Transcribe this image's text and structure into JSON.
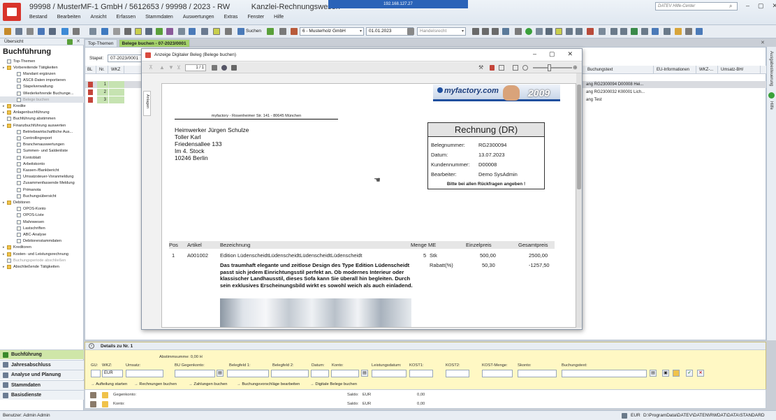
{
  "window": {
    "title": "99998 / MusterMF-1 GmbH / 5612653 / 99998 / 2023 - RW",
    "title_suffix": "Kanzlei-Rechnungswesen",
    "remote_ip": "192.168.127.27",
    "help_center_placeholder": "DATEV Hilfe-Center",
    "menu": [
      "Bestand",
      "Bearbeiten",
      "Ansicht",
      "Erfassen",
      "Stammdaten",
      "Auswertungen",
      "Extras",
      "Fenster",
      "Hilfe"
    ]
  },
  "toolbar": {
    "search_label": "Suchen",
    "client_select": "6 - Musterholz GmbH",
    "date_select": "01.01.2023",
    "law_select": "Handelsrecht"
  },
  "left_panel": {
    "header": "Übersicht",
    "title": "Buchführung",
    "items": [
      {
        "label": "Top-Themen",
        "level": 0,
        "kind": "leaf"
      },
      {
        "label": "Vorbereitende Tätigkeiten",
        "level": 0,
        "kind": "folder"
      },
      {
        "label": "Mandant ergänzen",
        "level": 1,
        "kind": "leaf"
      },
      {
        "label": "ASCII-Daten importieren",
        "level": 1,
        "kind": "leaf"
      },
      {
        "label": "Stapelverwaltung",
        "level": 1,
        "kind": "leaf"
      },
      {
        "label": "Wiederkehrende Buchunge...",
        "level": 1,
        "kind": "leaf"
      },
      {
        "label": "Belege buchen",
        "level": 1,
        "kind": "leaf",
        "state": "selected"
      },
      {
        "label": "Kredite",
        "level": 0,
        "kind": "folder"
      },
      {
        "label": "Anlagenbuchführung",
        "level": 0,
        "kind": "folder"
      },
      {
        "label": "Buchführung abstimmen",
        "level": 0,
        "kind": "leaf"
      },
      {
        "label": "Finanzbuchführung auswerten",
        "level": 0,
        "kind": "folder"
      },
      {
        "label": "Betriebswirtschaftliche Aus...",
        "level": 1,
        "kind": "leaf"
      },
      {
        "label": "Controllingreport",
        "level": 1,
        "kind": "leaf"
      },
      {
        "label": "Branchenauswertungen",
        "level": 1,
        "kind": "leaf"
      },
      {
        "label": "Summen- und Saldenliste",
        "level": 1,
        "kind": "leaf"
      },
      {
        "label": "Kontoblatt",
        "level": 1,
        "kind": "leaf"
      },
      {
        "label": "Arbeitskonto",
        "level": 1,
        "kind": "leaf"
      },
      {
        "label": "Kassen-/Bankbericht",
        "level": 1,
        "kind": "leaf"
      },
      {
        "label": "Umsatzsteuer-Voranmeldung",
        "level": 1,
        "kind": "leaf"
      },
      {
        "label": "Zusammenfassende Meldung",
        "level": 1,
        "kind": "leaf"
      },
      {
        "label": "Primanota",
        "level": 1,
        "kind": "leaf"
      },
      {
        "label": "Buchungsübersicht",
        "level": 1,
        "kind": "leaf"
      },
      {
        "label": "Debitoren",
        "level": 0,
        "kind": "folder"
      },
      {
        "label": "OPOS-Konto",
        "level": 1,
        "kind": "leaf"
      },
      {
        "label": "OPOS-Liste",
        "level": 1,
        "kind": "leaf"
      },
      {
        "label": "Mahnwesen",
        "level": 1,
        "kind": "leaf"
      },
      {
        "label": "Lastschriften",
        "level": 1,
        "kind": "leaf"
      },
      {
        "label": "ABC-Analyse",
        "level": 1,
        "kind": "leaf"
      },
      {
        "label": "Debitorenstammdaten",
        "level": 1,
        "kind": "leaf"
      },
      {
        "label": "Kreditoren",
        "level": 0,
        "kind": "folder"
      },
      {
        "label": "Kosten- und Leistungsrechnung",
        "level": 0,
        "kind": "folder"
      },
      {
        "label": "Buchungsperiode abschließen",
        "level": 0,
        "kind": "leaf",
        "state": "disabled"
      },
      {
        "label": "Abschließende Tätigkeiten",
        "level": 0,
        "kind": "folder"
      }
    ],
    "bottom_nav": [
      {
        "label": "Buchführung",
        "active": true
      },
      {
        "label": "Jahresabschluss",
        "active": false
      },
      {
        "label": "Analyse und Planung",
        "active": false
      },
      {
        "label": "Stammdaten",
        "active": false
      },
      {
        "label": "Basisdienste",
        "active": false
      }
    ]
  },
  "tabs": [
    {
      "label": "Top-Themen",
      "active": false
    },
    {
      "label": "Belege buchen - 07-2023/0001",
      "active": true
    }
  ],
  "main": {
    "stapel_label": "Stapel:",
    "stapel_value": "07-2023/0001",
    "columns": [
      "BL",
      "Nr.",
      "WKZ",
      "Buchungstext",
      "EU-Informationen",
      "WKZ-...",
      "Umsatz-BH/"
    ],
    "rows": [
      {
        "nr": "1",
        "text": "ang RG2300094 D00008 Hei..."
      },
      {
        "nr": "2",
        "text": "ang RG2300032 K00001 Lich..."
      },
      {
        "nr": "3",
        "text": "ang Test"
      }
    ],
    "right_labels": [
      "Ausgabesteuerung",
      "Hilfe"
    ]
  },
  "dialog": {
    "title": "Anzeige Digitaler Beleg (Belege buchen)",
    "page_indicator": "1 / 1",
    "side_tab": "Anlagen",
    "document": {
      "banner_logo": "myfactory.com",
      "banner_year": "2009",
      "sender_line": "myfactory - Rosenheimer Str. 141 - 80645 München",
      "address": [
        "Heimwerker Jürgen Schulze",
        "Toller Karl",
        "Friedensallee 133",
        "Im 4. Stock",
        "10246 Berlin"
      ],
      "invoice_title": "Rechnung (DR)",
      "fields": [
        {
          "label": "Belegnummer:",
          "value": "RG2300094"
        },
        {
          "label": "Datum:",
          "value": "13.07.2023"
        },
        {
          "label": "Kundennummer:",
          "value": "D00008"
        },
        {
          "label": "Bearbeiter:",
          "value": "Demo SysAdmin"
        }
      ],
      "invoice_note": "Bitte bei allen Rückfragen angeben !",
      "item_headers": [
        "Pos",
        "Artikel",
        "Bezeichnung",
        "Menge ME",
        "Einzelpreis",
        "Gesamtpreis"
      ],
      "item": {
        "pos": "1",
        "article": "A001002",
        "name": "Edition LüdenscheidtLüdenscheidtLüdenscheidtLüdenscheidt",
        "qty": "5",
        "unit": "Stk",
        "unit_price": "500,00",
        "total": "2500,00",
        "discount_label": "Rabatt(%)",
        "discount_value": "50,30",
        "discount_total": "-1257,50",
        "description": "Das traumhaft elegante und zeitlose Design des Type Edition Lüdenscheidt passt sich jedem Einrichtungsstil perfekt an. Ob modernes Interieur oder klassischer Landhausstil, dieses Sofa kann Sie überall hin begleiten. Durch sein exklusives Erscheinungsbild wirkt es sowohl weich als auch einladend."
      }
    }
  },
  "details": {
    "header": "Details zu Nr. 1",
    "abstimmsumme": "Abstimmsumme: 0,00 H",
    "labels": [
      "GU:",
      "WKZ:",
      "Umsatz:",
      "BU Gegenkonto:",
      "Belegfeld 1:",
      "Belegfeld 2:",
      "Datum:",
      "Konto:",
      "Leistungsdatum:",
      "KOST1:",
      "KOST2:",
      "KOST-Menge:",
      "Skonto:",
      "Buchungstext:"
    ],
    "wkz_value": "EUR",
    "actions": [
      "Aufteilung starten",
      "Rechnungen buchen",
      "Zahlungen buchen",
      "Buchungsvorschläge bearbeiten",
      "Digitale Belege buchen"
    ],
    "gegenkonto_label": "Gegenkonto:",
    "konto_label": "Konto:",
    "saldo_label": "Saldo:",
    "saldo_currency": "EUR",
    "saldo_value": "0,00"
  },
  "statusbar": {
    "user": "Benutzer: Admin Admin",
    "currency": "EUR",
    "path": "D:\\ProgramData\\DATEV\\DATEN\\RWDAT\\DATA\\STANDARD"
  }
}
